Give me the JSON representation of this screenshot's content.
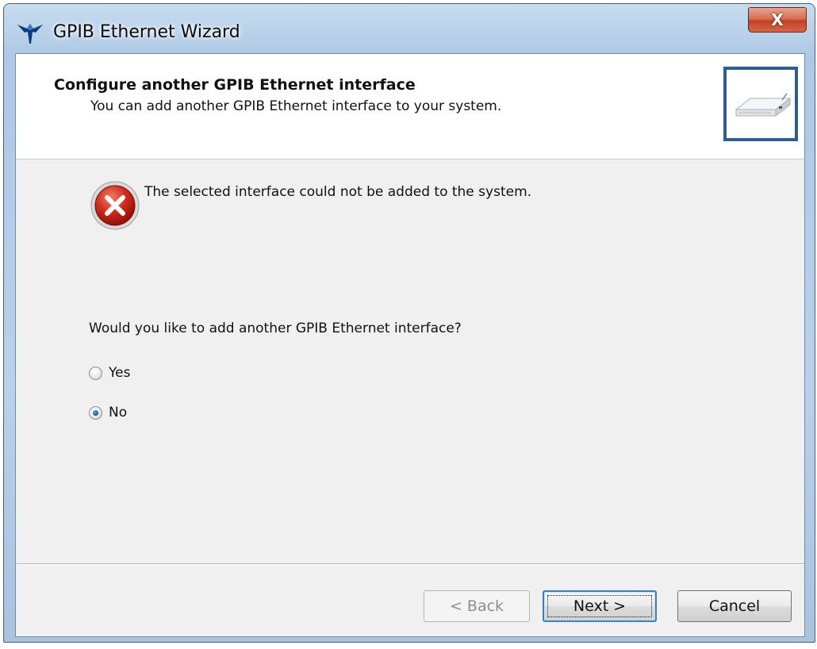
{
  "window": {
    "title": "GPIB Ethernet Wizard",
    "close_glyph": "X",
    "icon": "national-instruments-eagle-icon"
  },
  "header": {
    "title": "Configure another GPIB Ethernet interface",
    "subtitle": "You can add another GPIB Ethernet interface to your system.",
    "image": "gpib-ethernet-device-icon"
  },
  "message": {
    "icon": "error-icon",
    "text": "The selected interface could not be added to the system."
  },
  "question": {
    "text": "Would you like to add another GPIB Ethernet interface?",
    "options": [
      {
        "label": "Yes",
        "selected": false
      },
      {
        "label": "No",
        "selected": true
      }
    ]
  },
  "buttons": {
    "back_label": "< Back",
    "next_label": "Next >",
    "cancel_label": "Cancel",
    "back_enabled": false,
    "default": "next"
  },
  "colors": {
    "accent": "#2f5e8e",
    "error_red": "#c8102e",
    "client_bg": "#f0f0f0"
  }
}
